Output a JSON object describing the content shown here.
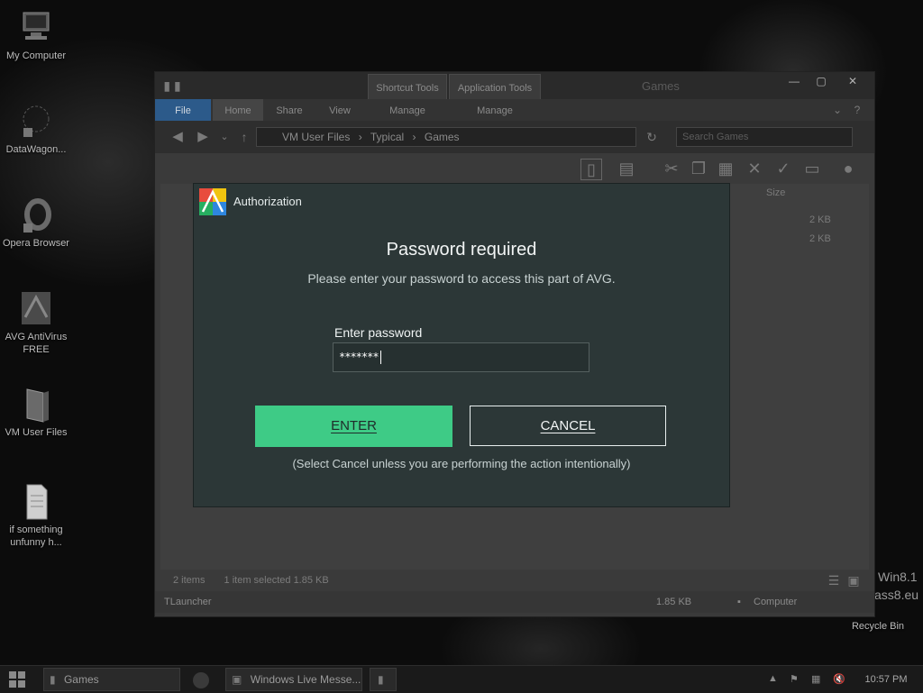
{
  "desktop": {
    "icons": [
      {
        "label": "My Computer",
        "icon": "computer-icon"
      },
      {
        "label": "DataWagon...",
        "icon": "datawagon-icon"
      },
      {
        "label": "Opera Browser",
        "icon": "opera-icon"
      },
      {
        "label": "AVG AntiVirus FREE",
        "icon": "avg-icon"
      },
      {
        "label": "VM User Files",
        "icon": "folder-icon"
      },
      {
        "label": "if something unfunny h...",
        "icon": "text-file-icon"
      }
    ],
    "recycle_bin_label": "Recycle Bin",
    "watermark": [
      "Win8.1",
      "ass8.eu"
    ]
  },
  "explorer": {
    "title": "Games",
    "context_tabs": [
      "Shortcut Tools",
      "Application Tools"
    ],
    "ribbon_tabs": [
      "File",
      "Home",
      "Share",
      "View",
      "Manage",
      "Manage"
    ],
    "breadcrumb": [
      "VM User Files",
      "Typical",
      "Games"
    ],
    "search_placeholder": "Search Games",
    "column_header_size": "Size",
    "file_sizes": [
      "2 KB",
      "2 KB"
    ],
    "status_items": "2 items",
    "status_selected": "1 item selected  1.85 KB",
    "detail_name": "TLauncher",
    "detail_size": "1.85 KB",
    "detail_location": "Computer"
  },
  "dialog": {
    "title": "Authorization",
    "heading": "Password required",
    "subtitle": "Please enter your password to access this part of AVG.",
    "password_label": "Enter password",
    "password_value": "*******",
    "enter_label": "ENTER",
    "cancel_label": "CANCEL",
    "note": "(Select Cancel unless you are performing the action intentionally)",
    "colors": {
      "background": "#2c3737",
      "accent": "#3ecb86"
    }
  },
  "taskbar": {
    "buttons": [
      {
        "label": "Games",
        "icon": "folder-icon"
      },
      {
        "label": "Windows Live Messe...",
        "icon": "messenger-icon"
      }
    ],
    "clock": "10:57 PM"
  }
}
